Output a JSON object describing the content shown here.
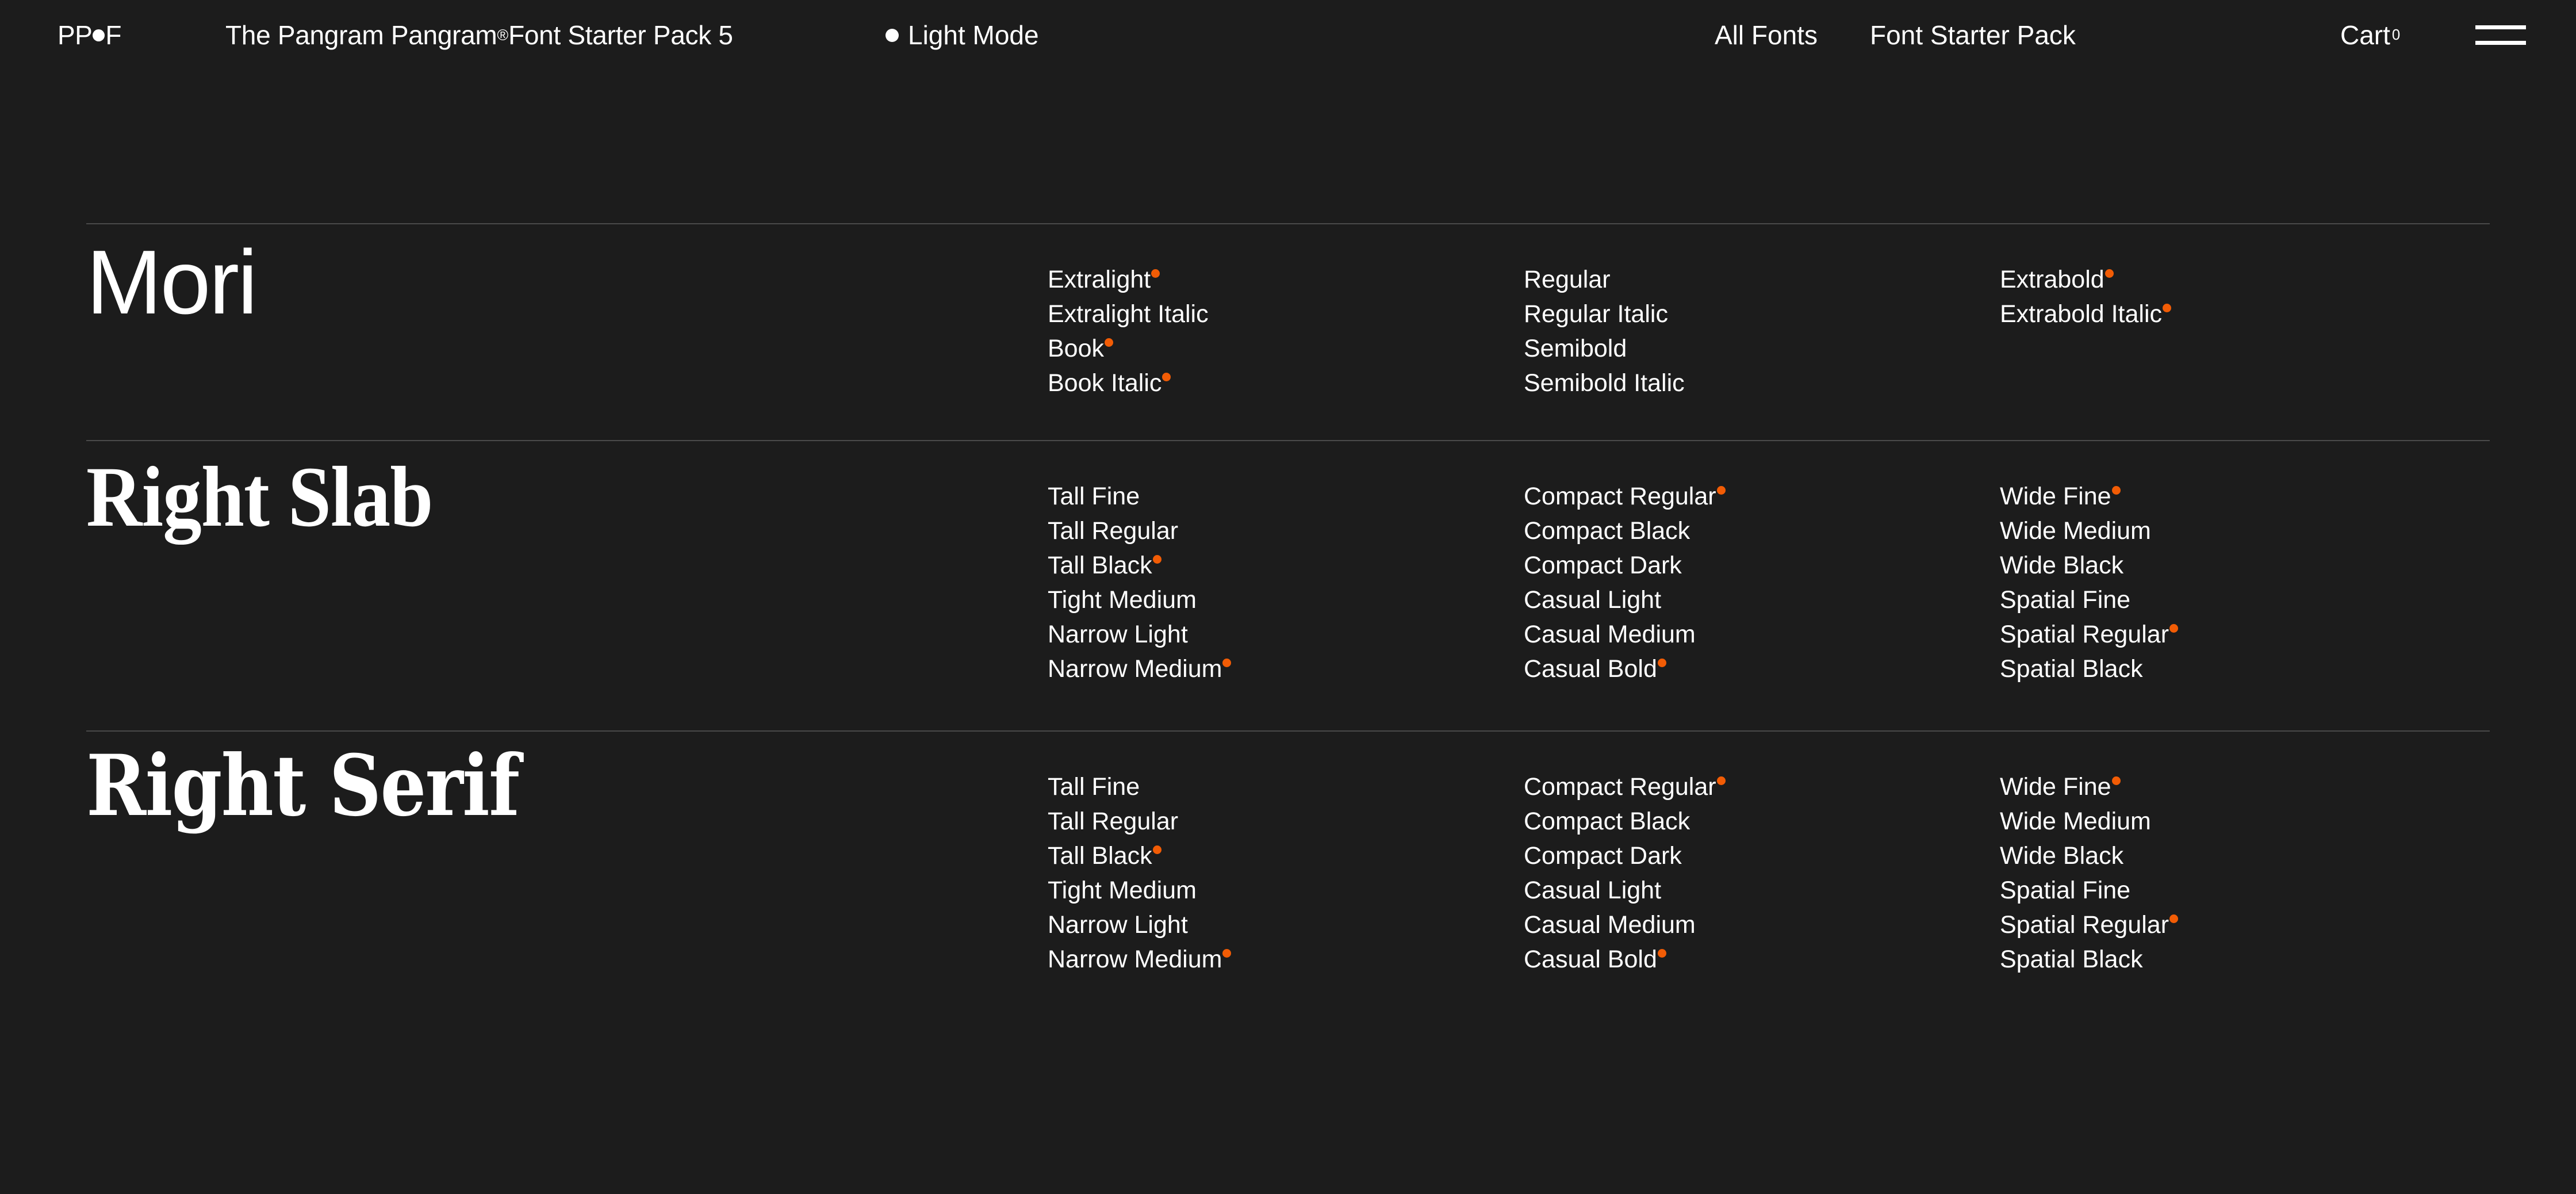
{
  "theme": {
    "background": "#1c1c1c",
    "text": "#ffffff",
    "accent": "#f25c05",
    "divider": "#4a4a4a"
  },
  "header": {
    "logo_pre": "PP",
    "logo_post": "F",
    "logo_icon": "circle-dot",
    "pack_title": "The Pangram Pangram",
    "pack_title_sup": "®",
    "pack_title_rest": " Font Starter Pack 5",
    "mode_toggle_label": "Light Mode",
    "nav_all_fonts": "All Fonts",
    "nav_font_starter_pack": "Font Starter Pack",
    "cart_label": "Cart",
    "cart_count": "0",
    "menu_icon": "hamburger-icon"
  },
  "sections": [
    {
      "id": "mori",
      "name": "Mori",
      "columns": [
        [
          {
            "label": "Extralight",
            "included": false
          },
          {
            "label": "Extralight Italic",
            "included": false
          },
          {
            "label": "Book",
            "included": true
          },
          {
            "label": "Book Italic",
            "included": true
          }
        ],
        [
          {
            "label": "Regular",
            "included": false
          },
          {
            "label": "Regular Italic",
            "included": false
          },
          {
            "label": "Semibold",
            "included": false
          },
          {
            "label": "Semibold Italic",
            "included": false
          }
        ],
        [
          {
            "label": "Extrabold",
            "included": true
          },
          {
            "label": "Extrabold Italic",
            "included": true
          }
        ]
      ]
    },
    {
      "id": "right-slab",
      "name": "Right Slab",
      "columns": [
        [
          {
            "label": "Tall Fine",
            "included": false
          },
          {
            "label": "Tall Regular",
            "included": false
          },
          {
            "label": "Tall Black",
            "included": true
          },
          {
            "label": "Tight Medium",
            "included": false
          },
          {
            "label": "Narrow Light",
            "included": false
          },
          {
            "label": "Narrow Medium",
            "included": true
          }
        ],
        [
          {
            "label": "Compact Regular",
            "included": true
          },
          {
            "label": "Compact Black",
            "included": false
          },
          {
            "label": "Compact Dark",
            "included": false
          },
          {
            "label": "Casual Light",
            "included": false
          },
          {
            "label": "Casual Medium",
            "included": false
          },
          {
            "label": "Casual Bold",
            "included": true
          }
        ],
        [
          {
            "label": "Wide Fine",
            "included": true
          },
          {
            "label": "Wide Medium",
            "included": false
          },
          {
            "label": "Wide Black",
            "included": false
          },
          {
            "label": "Spatial Fine",
            "included": false
          },
          {
            "label": "Spatial Regular",
            "included": true
          },
          {
            "label": "Spatial Black",
            "included": false
          }
        ]
      ]
    },
    {
      "id": "right-serif",
      "name": "Right Serif",
      "columns": [
        [
          {
            "label": "Tall Fine",
            "included": false
          },
          {
            "label": "Tall Regular",
            "included": false
          },
          {
            "label": "Tall Black",
            "included": true
          },
          {
            "label": "Tight Medium",
            "included": false
          },
          {
            "label": "Narrow Light",
            "included": false
          },
          {
            "label": "Narrow Medium",
            "included": true
          }
        ],
        [
          {
            "label": "Compact Regular",
            "included": true
          },
          {
            "label": "Compact Black",
            "included": false
          },
          {
            "label": "Compact Dark",
            "included": false
          },
          {
            "label": "Casual Light",
            "included": false
          },
          {
            "label": "Casual Medium",
            "included": false
          },
          {
            "label": "Casual Bold",
            "included": true
          }
        ],
        [
          {
            "label": "Wide Fine",
            "included": true
          },
          {
            "label": "Wide Medium",
            "included": false
          },
          {
            "label": "Wide Black",
            "included": false
          },
          {
            "label": "Spatial Fine",
            "included": false
          },
          {
            "label": "Spatial Regular",
            "included": true
          },
          {
            "label": "Spatial Black",
            "included": false
          }
        ]
      ]
    }
  ]
}
